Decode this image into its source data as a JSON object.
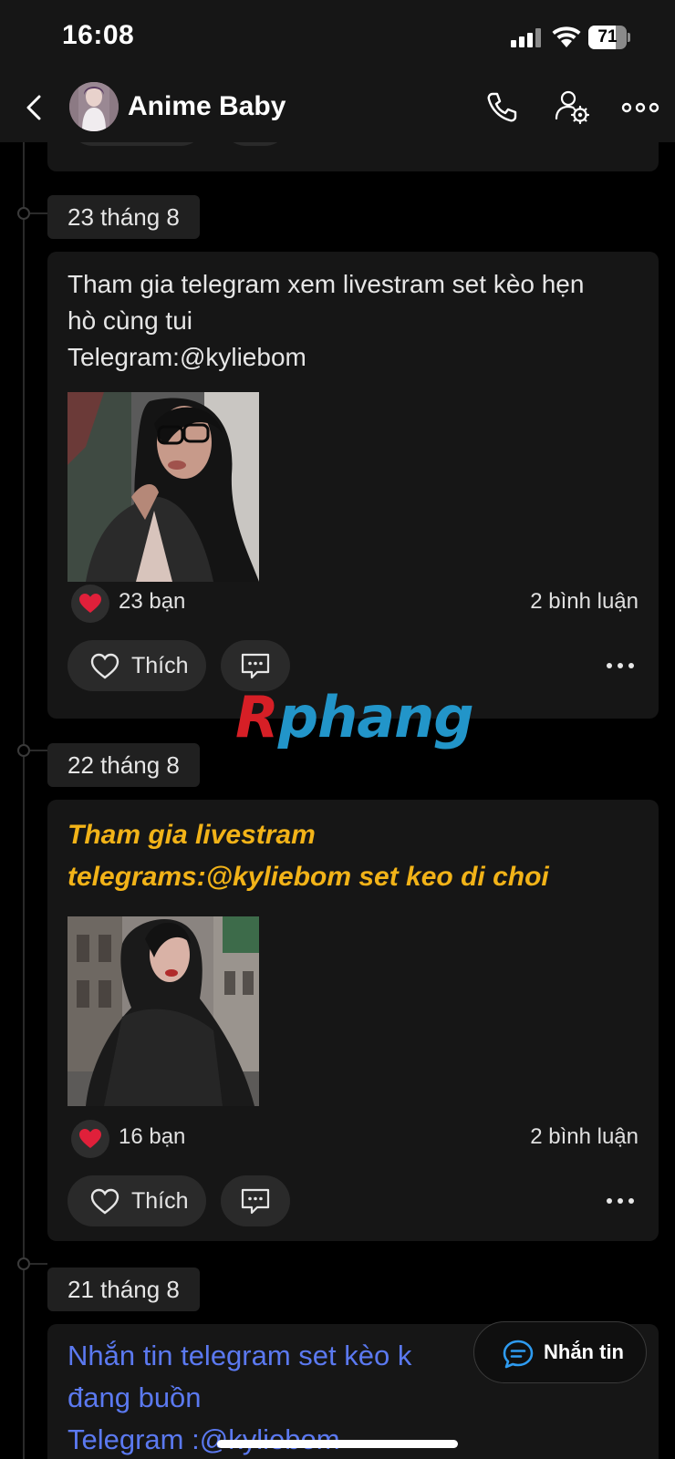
{
  "status_bar": {
    "time": "16:08",
    "battery_level": "71",
    "battery_fraction": 0.71,
    "icons": [
      "signal-icon",
      "wifi-icon",
      "battery-icon"
    ]
  },
  "header": {
    "title": "Anime Baby",
    "icons": [
      "chevron-left-icon",
      "phone-icon",
      "user-settings-icon",
      "more-horizontal-icon"
    ]
  },
  "posts": [
    {
      "date": "23 tháng 8",
      "text_lines": [
        "Tham gia telegram xem livestram set kèo hẹn",
        "hò cùng tui",
        "Telegram:@kyliebom"
      ],
      "reaction_count": "23 bạn",
      "comment_count": "2 bình luận",
      "like_label": "Thích"
    },
    {
      "date": "22 tháng 8",
      "text_lines": [
        "Tham gia livestram",
        "telegrams:@kyliebom set keo di choi"
      ],
      "text_color": "#f2b318",
      "reaction_count": "16 bạn",
      "comment_count": "2 bình luận",
      "like_label": "Thích"
    },
    {
      "date": "21 tháng 8",
      "text_lines": [
        "Nhắn tin telegram set kèo k",
        "đang buồn",
        "Telegram :@kyliebom"
      ],
      "text_color": "#5b79f0"
    }
  ],
  "watermark": {
    "first": "R",
    "rest": "phang"
  },
  "message_button": {
    "label": "Nhắn tin"
  },
  "colors": {
    "background": "#000000",
    "card": "#161616",
    "chip": "#202020",
    "heart": "#e0203a"
  }
}
